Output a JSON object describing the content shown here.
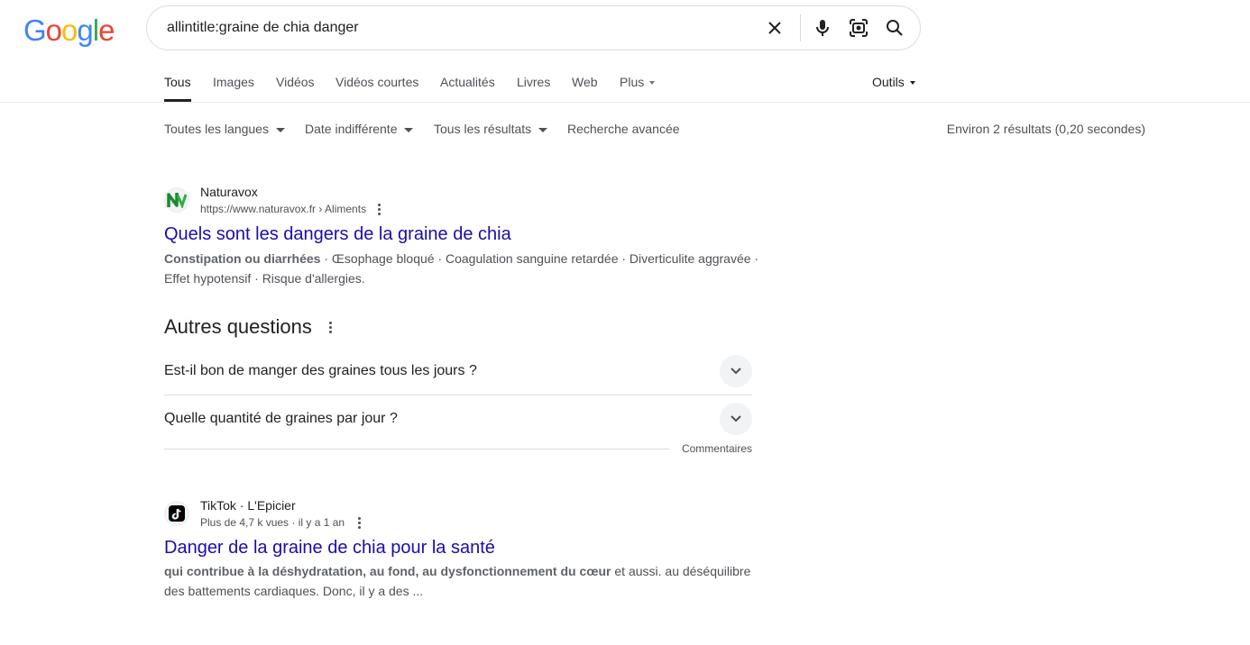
{
  "logo": {
    "letters": [
      "G",
      "o",
      "o",
      "g",
      "l",
      "e"
    ],
    "colors": [
      "#4285f4",
      "#ea4335",
      "#fbbc05",
      "#4285f4",
      "#34a853",
      "#ea4335"
    ]
  },
  "search": {
    "query": "allintitle:graine de chia danger"
  },
  "tabs": [
    {
      "label": "Tous",
      "active": true
    },
    {
      "label": "Images"
    },
    {
      "label": "Vidéos"
    },
    {
      "label": "Vidéos courtes"
    },
    {
      "label": "Actualités"
    },
    {
      "label": "Livres"
    },
    {
      "label": "Web"
    },
    {
      "label": "Plus"
    }
  ],
  "tools_label": "Outils",
  "filters": [
    "Toutes les langues",
    "Date indifférente",
    "Tous les résultats",
    "Recherche avancée"
  ],
  "stats": "Environ 2 résultats (0,20 secondes)",
  "result1": {
    "site": "Naturavox",
    "cite": "https://www.naturavox.fr › Aliments",
    "title": "Quels sont les dangers de la graine de chia",
    "snippet_bold": "Constipation ou diarrhées",
    "snippet_rest": " · Œsophage bloqué · Coagulation sanguine retardée · Diverticulite aggravée · Effet hypotensif · Risque d'allergies."
  },
  "paa": {
    "title": "Autres questions",
    "questions": [
      "Est-il bon de manger des graines tous les jours ?",
      "Quelle quantité de graines par jour ?"
    ],
    "feedback": "Commentaires"
  },
  "result2": {
    "site": "TikTok · L'Epicier",
    "cite": "Plus de 4,7 k vues · il y a 1 an",
    "title": "Danger de la graine de chia pour la santé",
    "snippet_bold": "qui contribue à la déshydratation, au fond, au dysfonctionnement du cœur",
    "snippet_rest": " et aussi. au déséquilibre des battements cardiaques. Donc, il y a des ..."
  },
  "colors": {
    "link": "#1a0dab",
    "text": "#202124",
    "muted": "#4d5156"
  },
  "icons": [
    "clear-icon",
    "microphone-icon",
    "camera-lens-icon",
    "search-icon",
    "kebab-menu-icon",
    "chevron-down-icon",
    "naturavox-logo-icon",
    "tiktok-logo-icon"
  ]
}
